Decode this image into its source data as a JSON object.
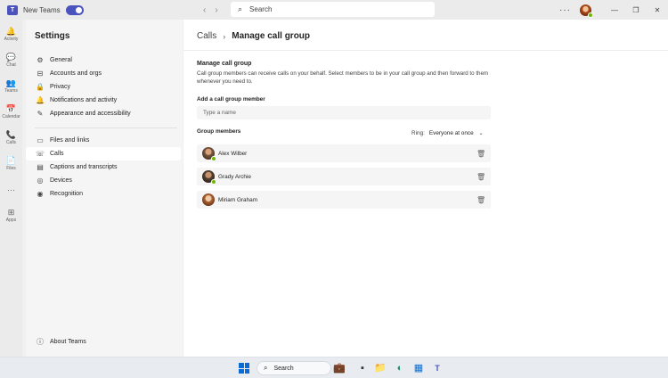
{
  "titlebar": {
    "app_label": "New Teams",
    "logo_letter": "T",
    "search_placeholder": "Search",
    "more": "···",
    "window_controls": {
      "minimize": "—",
      "restore": "❐",
      "close": "✕"
    }
  },
  "rail": {
    "items": [
      {
        "icon": "bell-icon",
        "glyph": "🔔",
        "label": "Activity"
      },
      {
        "icon": "chat-icon",
        "glyph": "💬",
        "label": "Chat"
      },
      {
        "icon": "teams-icon",
        "glyph": "👥",
        "label": "Teams"
      },
      {
        "icon": "calendar-icon",
        "glyph": "📅",
        "label": "Calendar"
      },
      {
        "icon": "phone-icon",
        "glyph": "📞",
        "label": "Calls"
      },
      {
        "icon": "files-icon",
        "glyph": "📄",
        "label": "Files"
      },
      {
        "icon": "more-icon",
        "glyph": "···",
        "label": ""
      },
      {
        "icon": "apps-icon",
        "glyph": "⊞",
        "label": "Apps"
      }
    ]
  },
  "settings": {
    "title": "Settings",
    "items": [
      {
        "icon": "gear-icon",
        "glyph": "⚙",
        "label": "General"
      },
      {
        "icon": "accounts-icon",
        "glyph": "⊟",
        "label": "Accounts and orgs"
      },
      {
        "icon": "lock-icon",
        "glyph": "🔒",
        "label": "Privacy"
      },
      {
        "icon": "bell-icon",
        "glyph": "🔔",
        "label": "Notifications and activity"
      },
      {
        "icon": "paintbrush-icon",
        "glyph": "✎",
        "label": "Appearance and accessibility"
      },
      {
        "icon": "file-icon",
        "glyph": "▭",
        "label": "Files and links"
      },
      {
        "icon": "phone-icon",
        "glyph": "☏",
        "label": "Calls"
      },
      {
        "icon": "captions-icon",
        "glyph": "▤",
        "label": "Captions and transcripts"
      },
      {
        "icon": "devices-icon",
        "glyph": "◎",
        "label": "Devices"
      },
      {
        "icon": "recognition-icon",
        "glyph": "◉",
        "label": "Recognition"
      }
    ],
    "about": {
      "icon": "info-icon",
      "glyph": "ⓘ",
      "label": "About Teams"
    }
  },
  "main": {
    "breadcrumb": {
      "parent": "Calls",
      "separator": "›",
      "current": "Manage call group"
    },
    "section_title": "Manage call group",
    "description": "Call group members can receive calls on your behalf. Select members to be in your call group and then forward to them whenever you need to.",
    "add_label": "Add a call group member",
    "add_placeholder": "Type a name",
    "members_label": "Group members",
    "ring_label": "Ring:",
    "ring_value": "Everyone at once",
    "members": [
      {
        "name": "Alex Wilber",
        "avatar_color": "#7b5a44"
      },
      {
        "name": "Grady Archie",
        "avatar_color": "#5a4636"
      },
      {
        "name": "Miriam Graham",
        "avatar_color": "#b06a3a"
      }
    ]
  },
  "taskbar": {
    "search_placeholder": "Search"
  },
  "colors": {
    "brand": "#4b53bc",
    "presence_available": "#6bb700",
    "windows_blue": "#0a6cd4"
  }
}
